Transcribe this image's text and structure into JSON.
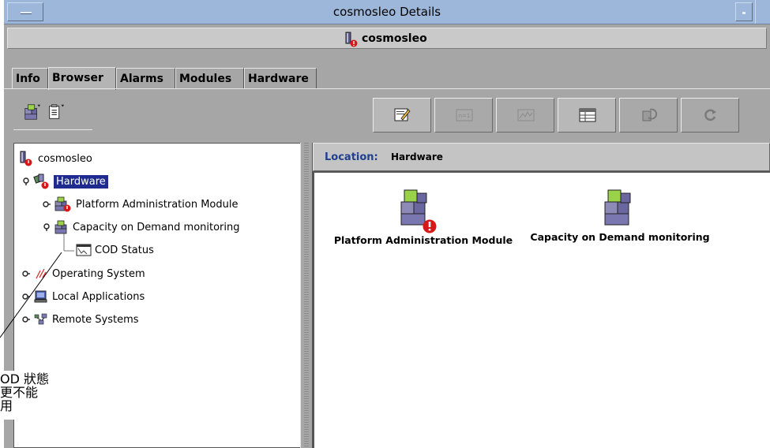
{
  "window": {
    "title": "cosmosleo Details"
  },
  "host": {
    "name": "cosmosleo"
  },
  "tabs": [
    {
      "label": "Info"
    },
    {
      "label": "Browser"
    },
    {
      "label": "Alarms"
    },
    {
      "label": "Modules"
    },
    {
      "label": "Hardware"
    }
  ],
  "active_tab": "Browser",
  "toolbar": {
    "left_icons": [
      "host-menu-icon",
      "document-menu-icon"
    ],
    "right_buttons": [
      {
        "icon": "edit-icon",
        "enabled": true
      },
      {
        "icon": "n-plus-1-icon",
        "enabled": false
      },
      {
        "icon": "graph-icon",
        "enabled": false
      },
      {
        "icon": "table-view-icon",
        "enabled": true
      },
      {
        "icon": "refresh-props-icon",
        "enabled": false
      },
      {
        "icon": "reload-icon",
        "enabled": false
      }
    ]
  },
  "tree": {
    "root": "cosmosleo",
    "items": [
      {
        "label": "cosmosleo",
        "icon": "server-icon",
        "alarm": true
      },
      {
        "label": "Hardware",
        "icon": "hardware-icon",
        "alarm": true,
        "selected": true
      },
      {
        "label": "Platform Administration Module",
        "icon": "module-icon",
        "alarm": true
      },
      {
        "label": "Capacity on Demand monitoring",
        "icon": "module-icon",
        "alarm": false
      },
      {
        "label": "COD Status",
        "icon": "table-icon",
        "alarm": false
      },
      {
        "label": "Operating System",
        "icon": "os-icon",
        "alarm": false
      },
      {
        "label": "Local Applications",
        "icon": "applications-icon",
        "alarm": false
      },
      {
        "label": "Remote Systems",
        "icon": "network-icon",
        "alarm": false
      }
    ]
  },
  "location": {
    "label": "Location:",
    "value": "Hardware"
  },
  "content": {
    "items": [
      {
        "label": "Platform Administration Module",
        "alarm": true
      },
      {
        "label": "Capacity on Demand monitoring",
        "alarm": false
      }
    ]
  },
  "annotation": {
    "lines": [
      "OD 狀態",
      "更不能",
      "用"
    ]
  },
  "colors": {
    "titlebar": "#9db7da",
    "selection": "#1f2b8e",
    "location_label": "#1f3f8f",
    "alarm": "#d81818",
    "cube_green": "#9ad24a",
    "cube_purple": "#8d8ab8"
  }
}
